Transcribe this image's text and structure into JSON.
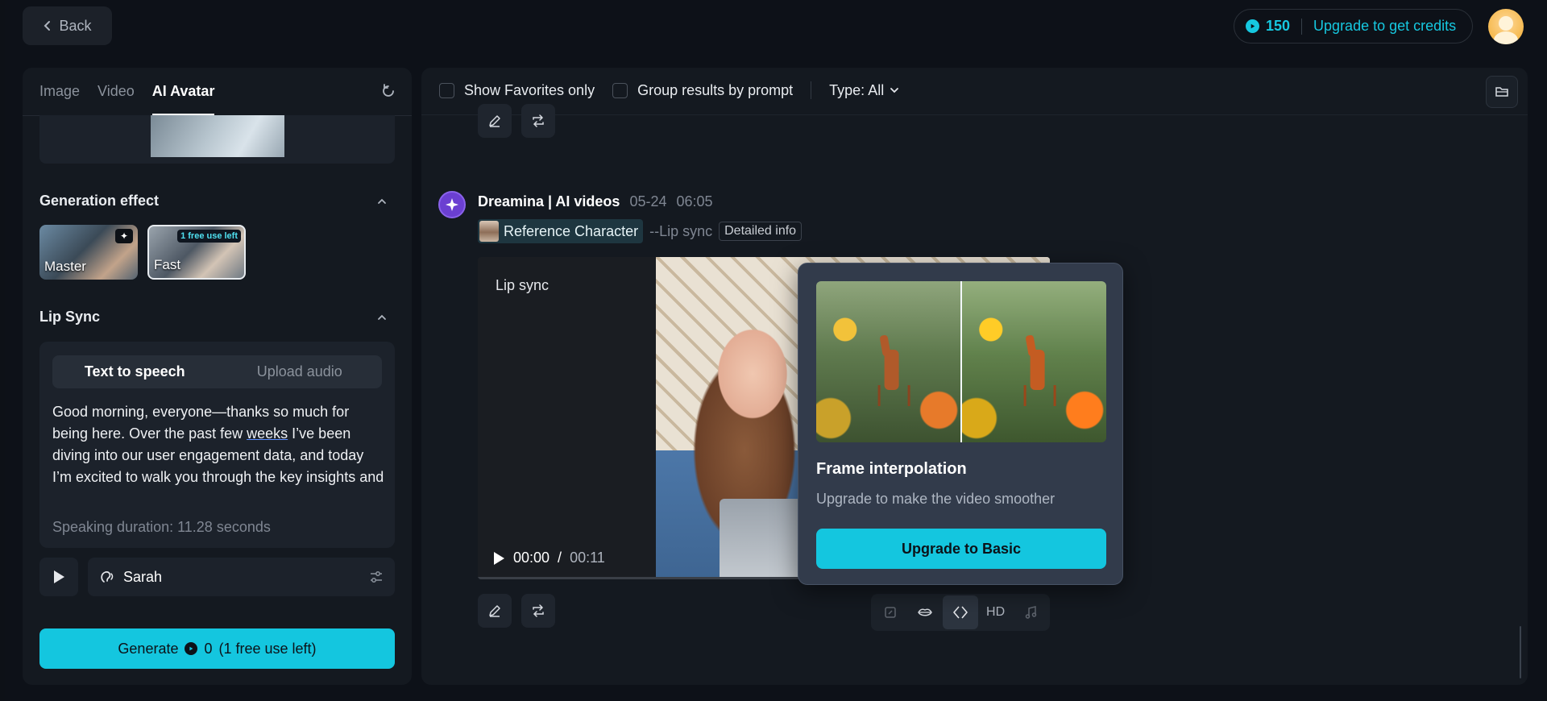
{
  "header": {
    "back_label": "Back",
    "credits_value": "150",
    "upgrade_credits_label": "Upgrade to get credits"
  },
  "left_panel": {
    "tabs": [
      {
        "label": "Image",
        "active": false
      },
      {
        "label": "Video",
        "active": false
      },
      {
        "label": "AI Avatar",
        "active": true
      }
    ],
    "generation_effect": {
      "title": "Generation effect",
      "options": [
        {
          "label": "Master",
          "badge": "",
          "selected": false
        },
        {
          "label": "Fast",
          "badge": "1 free use left",
          "selected": true
        }
      ]
    },
    "lip_sync": {
      "title": "Lip Sync",
      "mode_tabs": [
        {
          "label": "Text to speech",
          "active": true
        },
        {
          "label": "Upload audio",
          "active": false
        }
      ],
      "speech_text_1": "Good morning, everyone—thanks so much for being here. Over the past few ",
      "speech_underlined": "weeks",
      "speech_text_2": " I’ve been diving into our user engagement data, and today I’m excited to walk you through the key insights and recommendations.",
      "duration": "Speaking duration: 11.28 seconds",
      "voice_name": "Sarah"
    },
    "generate": {
      "label": "Generate",
      "cost": "0",
      "note": "(1 free use left)"
    }
  },
  "right_panel": {
    "filters": {
      "favorites_label": "Show Favorites only",
      "group_label": "Group results by prompt",
      "type_label": "Type: All"
    },
    "result": {
      "author": "Dreamina | AI videos",
      "date": "05-24",
      "time": "06:05",
      "reference_label": "Reference Character",
      "mode_tag": "--Lip sync",
      "detail_button": "Detailed info",
      "video_label": "Lip sync",
      "current_time": "00:00",
      "time_separator": "/",
      "total_time": "00:11",
      "tools": {
        "hd_label": "HD"
      }
    },
    "popover": {
      "title": "Frame interpolation",
      "subtitle": "Upgrade to make the video smoother",
      "button": "Upgrade to Basic"
    }
  },
  "colors": {
    "accent": "#14c6df",
    "background": "#0d1117",
    "panel": "#141920",
    "brand_purple": "#6b3fd1"
  }
}
